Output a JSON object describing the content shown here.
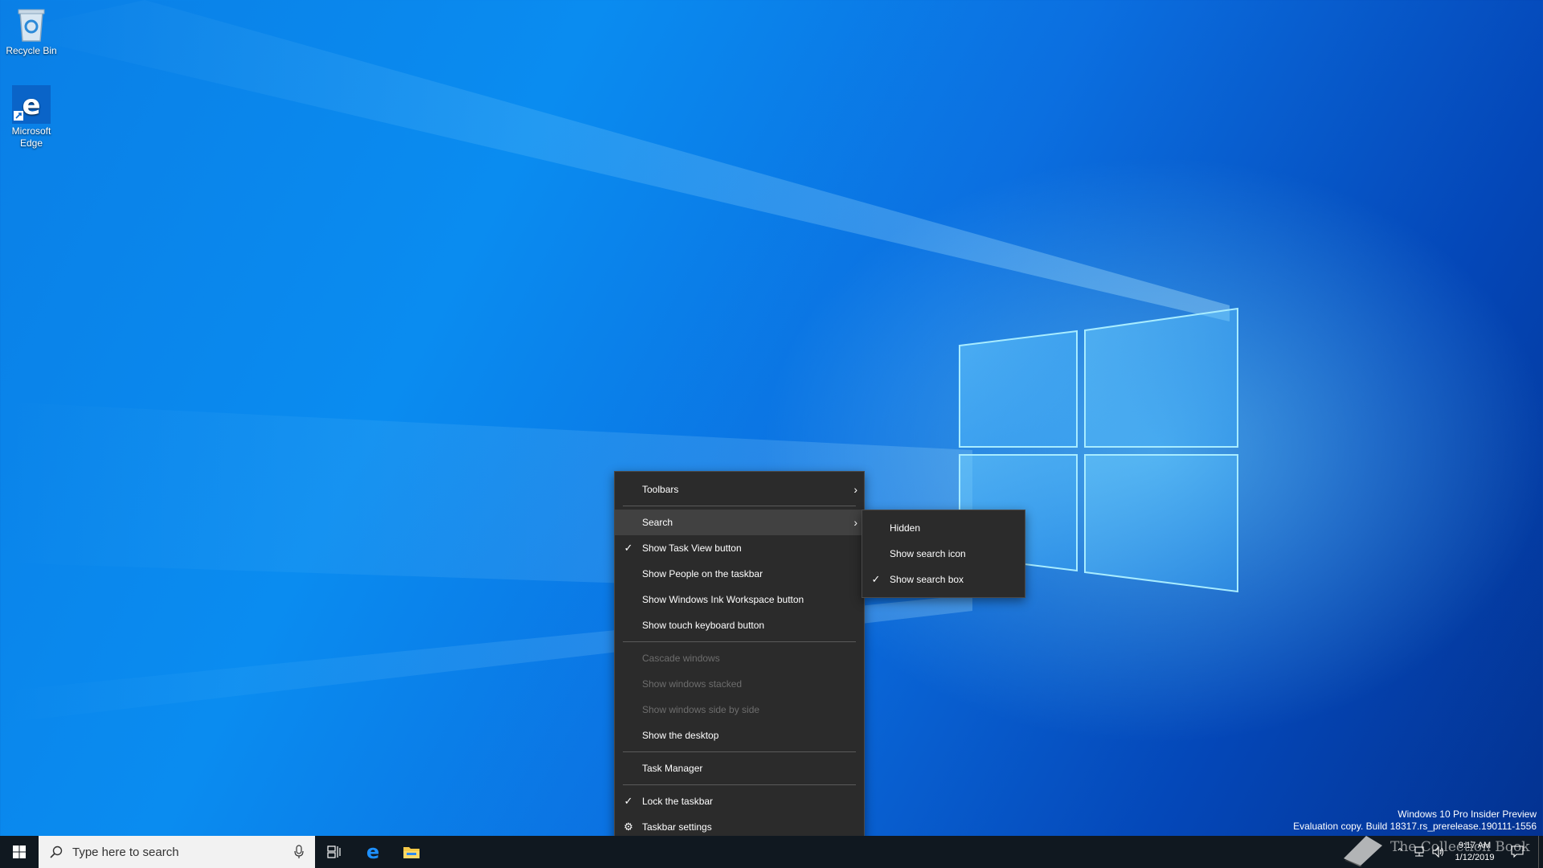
{
  "desktop": {
    "icons": [
      {
        "label": "Recycle Bin",
        "icon": "recycle-bin-icon"
      },
      {
        "label": "Microsoft Edge",
        "icon": "edge-icon"
      }
    ],
    "watermark_line1": "Windows 10 Pro Insider Preview",
    "watermark_line2": "Evaluation copy. Build 18317.rs_prerelease.190111-1556",
    "overlay_text": "The Collection Book"
  },
  "context_menu": {
    "items": [
      {
        "label": "Toolbars",
        "checked": false,
        "submenu": true,
        "enabled": true
      },
      {
        "label": "Search",
        "checked": false,
        "submenu": true,
        "enabled": true,
        "highlighted": true
      },
      {
        "label": "Show Task View button",
        "checked": true,
        "enabled": true
      },
      {
        "label": "Show People on the taskbar",
        "checked": false,
        "enabled": true
      },
      {
        "label": "Show Windows Ink Workspace button",
        "checked": false,
        "enabled": true
      },
      {
        "label": "Show touch keyboard button",
        "checked": false,
        "enabled": true
      },
      {
        "label": "Cascade windows",
        "enabled": false
      },
      {
        "label": "Show windows stacked",
        "enabled": false
      },
      {
        "label": "Show windows side by side",
        "enabled": false
      },
      {
        "label": "Show the desktop",
        "enabled": true
      },
      {
        "label": "Task Manager",
        "enabled": true
      },
      {
        "label": "Lock the taskbar",
        "checked": true,
        "enabled": true
      },
      {
        "label": "Taskbar settings",
        "icon": "gear-icon",
        "enabled": true
      }
    ]
  },
  "search_submenu": {
    "items": [
      {
        "label": "Hidden",
        "checked": false
      },
      {
        "label": "Show search icon",
        "checked": false
      },
      {
        "label": "Show search box",
        "checked": true
      }
    ]
  },
  "taskbar": {
    "search_placeholder": "Type here to search",
    "clock_time": "9:17 AM",
    "clock_date": "1/12/2019"
  }
}
